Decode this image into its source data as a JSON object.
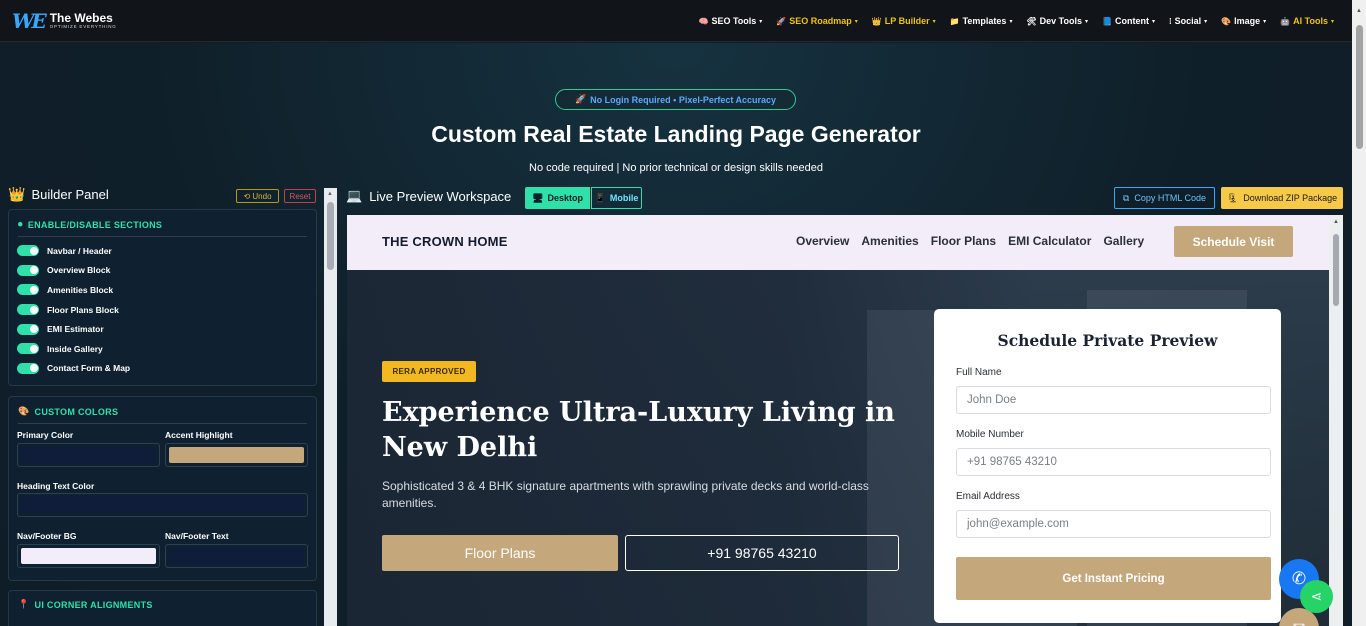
{
  "brand": {
    "name": "The Webes",
    "tagline": "OPTIMIZE EVERYTHING"
  },
  "nav": [
    {
      "icon": "🧠",
      "label": "SEO Tools",
      "accent": false
    },
    {
      "icon": "🚀",
      "label": "SEO Roadmap",
      "accent": true
    },
    {
      "icon": "👑",
      "label": "LP Builder",
      "accent": true
    },
    {
      "icon": "📁",
      "label": "Templates",
      "accent": false
    },
    {
      "icon": "🛠",
      "label": "Dev Tools",
      "accent": false
    },
    {
      "icon": "📘",
      "label": "Content",
      "accent": false
    },
    {
      "icon": "⁞",
      "label": "Social",
      "accent": false
    },
    {
      "icon": "🎨",
      "label": "Image",
      "accent": false
    },
    {
      "icon": "🤖",
      "label": "AI Tools",
      "accent": true
    }
  ],
  "hero": {
    "pill": "No Login Required • Pixel-Perfect Accuracy",
    "title": "Custom Real Estate Landing Page Generator",
    "subtitle": "No code required | No prior technical or design skills needed"
  },
  "builder": {
    "title": "Builder Panel",
    "undo": "Undo",
    "reset": "Reset",
    "sections_head": "ENABLE/DISABLE SECTIONS",
    "sections": [
      "Navbar / Header",
      "Overview Block",
      "Amenities Block",
      "Floor Plans Block",
      "EMI Estimator",
      "Inside Gallery",
      "Contact Form & Map"
    ],
    "colors_head": "CUSTOM COLORS",
    "colors": {
      "primary": {
        "label": "Primary Color",
        "value": "#0f1d3a"
      },
      "accent": {
        "label": "Accent Highlight",
        "value": "#c4a77b"
      },
      "heading": {
        "label": "Heading Text Color",
        "value": "#0f1d3a"
      },
      "navbg": {
        "label": "Nav/Footer BG",
        "value": "#f2edf9"
      },
      "navtext": {
        "label": "Nav/Footer Text",
        "value": "#0f1d3a"
      }
    },
    "align_head": "UI CORNER ALIGNMENTS"
  },
  "workspace": {
    "title": "Live Preview Workspace",
    "desktop": "Desktop",
    "mobile": "Mobile",
    "copy": "Copy HTML Code",
    "zip": "Download ZIP Package"
  },
  "preview": {
    "brand": "THE CROWN HOME",
    "links": [
      "Overview",
      "Amenities",
      "Floor Plans",
      "EMI Calculator",
      "Gallery"
    ],
    "cta": "Schedule Visit",
    "badge": "RERA APPROVED",
    "heading": "Experience Ultra-Luxury Living in New Delhi",
    "para": "Sophisticated 3 & 4 BHK signature apartments with sprawling private decks and world-class amenities.",
    "btn_primary": "Floor Plans",
    "btn_phone": "+91 98765 43210",
    "form": {
      "title": "Schedule Private Preview",
      "name_label": "Full Name",
      "name_ph": "John Doe",
      "mobile_label": "Mobile Number",
      "mobile_ph": "+91 98765 43210",
      "email_label": "Email Address",
      "email_ph": "john@example.com",
      "submit": "Get Instant Pricing"
    }
  }
}
